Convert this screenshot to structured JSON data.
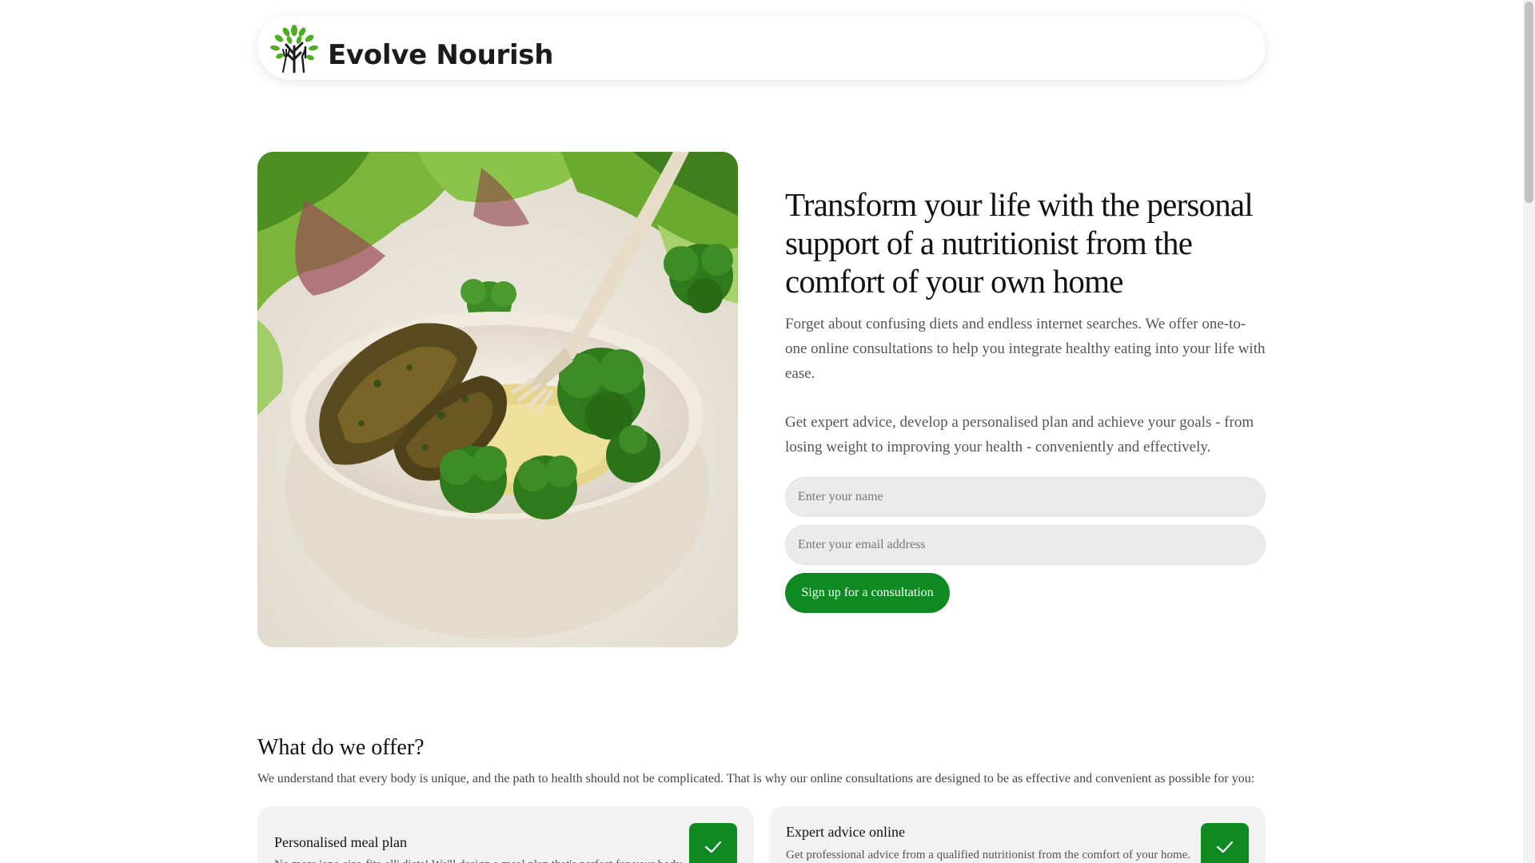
{
  "header": {
    "logo_text": "Evolve Nourish"
  },
  "hero": {
    "image_alt": "Bowl with vegetable patties, rice and broccoli next to salad greens",
    "title": "Transform your life with the personal support of a nutritionist from the comfort of your own home",
    "paragraph_1": "Forget about confusing diets and endless internet searches. We offer one-to-one online consultations to help you integrate healthy eating into your life with ease.",
    "paragraph_2": "Get expert advice, develop a personalised plan and achieve your goals - from losing weight to improving your health - conveniently and effectively.",
    "form": {
      "name_placeholder": "Enter your name",
      "email_placeholder": "Enter your email address",
      "submit_label": "Sign up for a consultation"
    }
  },
  "offer": {
    "title": "What do we offer?",
    "subtitle": "We understand that every body is unique, and the path to health should not be complicated. That is why our online consultations are designed to be as effective and convenient as possible for you:",
    "cards": [
      {
        "title": "Personalised meal plan",
        "desc": "No more 'one-size-fits-all' diets! We'll design a meal plan that's perfect for your body and goals.",
        "icon": "check-icon"
      },
      {
        "title": "Expert advice online",
        "desc": "Get professional advice from a qualified nutritionist from the comfort of your home.",
        "icon": "check-icon"
      }
    ]
  },
  "colors": {
    "brand_green": "#0f8a23",
    "field_bg": "#ebebeb",
    "card_bg": "#f2f2f2"
  }
}
